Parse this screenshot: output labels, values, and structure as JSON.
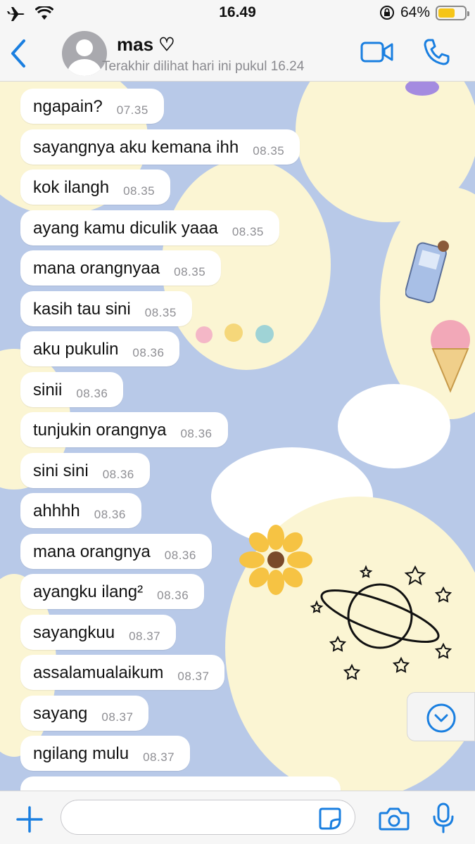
{
  "status_bar": {
    "time": "16.49",
    "battery_percent": "64%",
    "battery_level": 0.64
  },
  "header": {
    "name": "mas ♡",
    "status": "Terakhir dilihat hari ini pukul 16.24"
  },
  "messages": [
    {
      "text": "ngapain?",
      "time": "07.35"
    },
    {
      "text": "sayangnya aku kemana ihh",
      "time": "08.35"
    },
    {
      "text": "kok ilangh",
      "time": "08.35"
    },
    {
      "text": "ayang kamu diculik yaaa",
      "time": "08.35"
    },
    {
      "text": "mana orangnyaa",
      "time": "08.35"
    },
    {
      "text": "kasih tau sini",
      "time": "08.35"
    },
    {
      "text": "aku pukulin",
      "time": "08.36"
    },
    {
      "text": "sinii",
      "time": "08.36"
    },
    {
      "text": "tunjukin orangnya",
      "time": "08.36"
    },
    {
      "text": "sini sini",
      "time": "08.36"
    },
    {
      "text": "ahhhh",
      "time": "08.36"
    },
    {
      "text": "mana orangnya",
      "time": "08.36"
    },
    {
      "text": "ayangku ilang²",
      "time": "08.36"
    },
    {
      "text": "sayangkuu",
      "time": "08.37"
    },
    {
      "text": "assalamualaikum",
      "time": "08.37"
    },
    {
      "text": "sayang",
      "time": "08.37"
    },
    {
      "text": "ngilang mulu",
      "time": "08.37"
    }
  ],
  "input": {
    "placeholder": ""
  },
  "colors": {
    "accent": "#1a7fe0",
    "bubble": "#ffffff",
    "timestamp": "#8e8e93"
  },
  "icons": [
    "airplane-icon",
    "wifi-icon",
    "lock-rotation-icon",
    "battery-icon",
    "back-chevron-icon",
    "video-call-icon",
    "phone-icon",
    "scroll-down-icon",
    "plus-icon",
    "sticker-icon",
    "camera-icon",
    "microphone-icon"
  ]
}
